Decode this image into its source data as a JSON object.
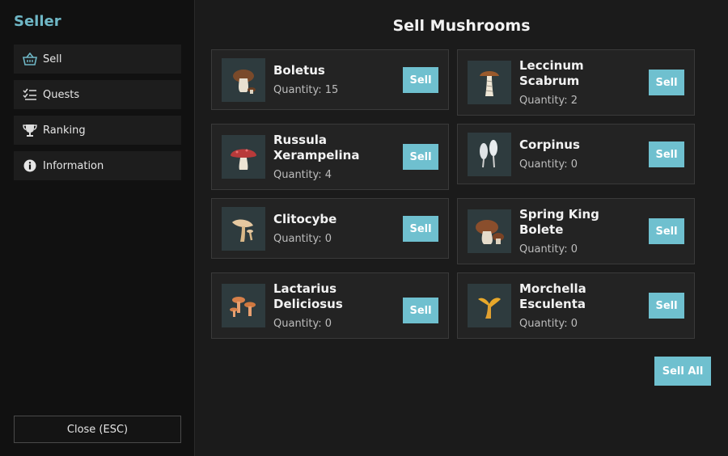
{
  "sidebar": {
    "title": "Seller",
    "items": [
      {
        "label": "Sell",
        "icon": "basket-icon"
      },
      {
        "label": "Quests",
        "icon": "checklist-icon"
      },
      {
        "label": "Ranking",
        "icon": "trophy-icon"
      },
      {
        "label": "Information",
        "icon": "info-icon"
      }
    ],
    "close_label": "Close (ESC)"
  },
  "main": {
    "title": "Sell Mushrooms",
    "sell_label": "Sell",
    "sell_all_label": "Sell All",
    "items": [
      {
        "name": "Boletus",
        "quantity": "Quantity: 15"
      },
      {
        "name": "Leccinum Scabrum",
        "quantity": "Quantity: 2"
      },
      {
        "name": "Russula Xerampelina",
        "quantity": "Quantity: 4"
      },
      {
        "name": "Corpinus",
        "quantity": "Quantity: 0"
      },
      {
        "name": "Clitocybe",
        "quantity": "Quantity: 0"
      },
      {
        "name": "Spring King Bolete",
        "quantity": "Quantity: 0"
      },
      {
        "name": "Lactarius Deliciosus",
        "quantity": "Quantity: 0"
      },
      {
        "name": "Morchella Esculenta",
        "quantity": "Quantity: 0"
      }
    ]
  },
  "colors": {
    "accent": "#6fc0cf",
    "sidebar_bg": "#111111",
    "panel_bg": "#1b1b1b",
    "card_bg": "#232323"
  }
}
